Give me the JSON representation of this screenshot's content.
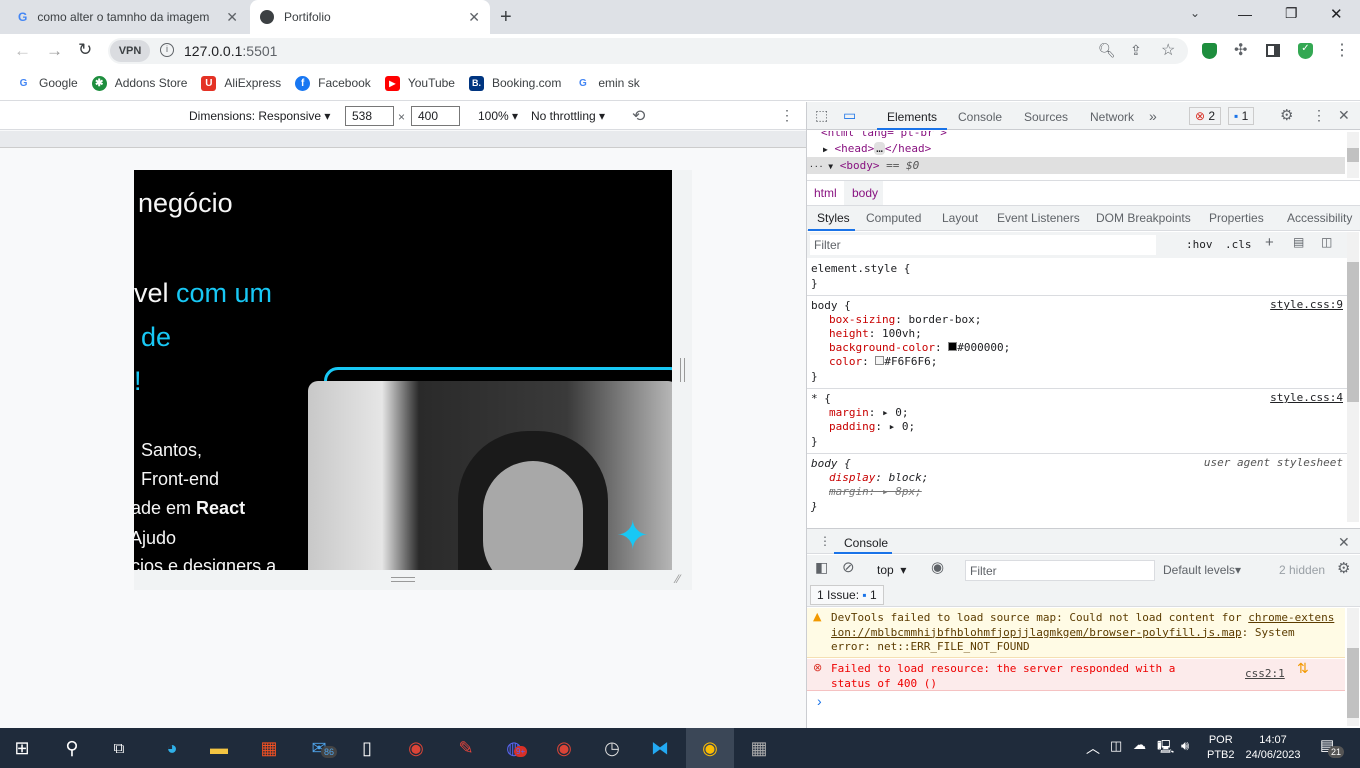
{
  "browser": {
    "tabs": [
      {
        "title": "como alter o tamnho da imagem",
        "icon": "google-icon"
      },
      {
        "title": "Portifolio",
        "icon": "globe-icon"
      }
    ],
    "vpn_label": "VPN",
    "url_host": "127.0.0.1",
    "url_port": ":5501",
    "bookmarks": [
      {
        "label": "Google",
        "color": "#4285f4",
        "glyph": "G"
      },
      {
        "label": "Addons Store",
        "color": "#1e8e3e",
        "glyph": "✱"
      },
      {
        "label": "AliExpress",
        "color": "#e43225",
        "glyph": "U"
      },
      {
        "label": "Facebook",
        "color": "#1877f2",
        "glyph": "f"
      },
      {
        "label": "YouTube",
        "color": "#ff0000",
        "glyph": "▶"
      },
      {
        "label": "Booking.com",
        "color": "#003580",
        "glyph": "B."
      },
      {
        "label": "emin sk",
        "color": "#4285f4",
        "glyph": "G"
      }
    ]
  },
  "device_toolbar": {
    "dimensions": "Dimensions: Responsive",
    "width": "538",
    "times": "×",
    "height": "400",
    "zoom": "100%",
    "throttling": "No throttling"
  },
  "page": {
    "line1": "negócio",
    "line2_white": "vel ",
    "line2_cyan": "com um",
    "line3_cyan": "de",
    "line4_cyan": "!",
    "p1": "Santos,",
    "p2": "Front-end",
    "p3_a": "ade em ",
    "p3_b": "React",
    ",p3_c": ",",
    "p4": "Ajudo",
    "p5": "cios e designers a",
    "accent": "#18c8f5"
  },
  "devtools": {
    "tabs": [
      "Elements",
      "Console",
      "Sources",
      "Network"
    ],
    "more": "»",
    "errors": "2",
    "messages": "1",
    "dom": {
      "html_line": "<html lang=\"pt-br\">",
      "head_open": "<head>",
      "head_close": "</head>",
      "body": "<body>",
      "body_suffix": "== $0"
    },
    "breadcrumbs": [
      "html",
      "body"
    ],
    "style_tabs": [
      "Styles",
      "Computed",
      "Layout",
      "Event Listeners",
      "DOM Breakpoints",
      "Properties",
      "Accessibility"
    ],
    "filter_placeholder": "Filter",
    "hov": ":hov",
    "cls": ".cls",
    "rules": [
      {
        "selector": "element.style {",
        "source": "",
        "props": [],
        "close": "}"
      },
      {
        "selector": "body {",
        "source": "style.css:9",
        "props": [
          {
            "name": "box-sizing",
            "value": "border-box;"
          },
          {
            "name": "height",
            "value": "100vh;"
          },
          {
            "name": "background-color",
            "value": "#000000;",
            "swatch": "#000000"
          },
          {
            "name": "color",
            "value": "#F6F6F6;",
            "swatch": "#F6F6F6"
          }
        ],
        "close": "}"
      },
      {
        "selector": "* {",
        "source": "style.css:4",
        "props": [
          {
            "name": "margin",
            "value": "▸ 0;"
          },
          {
            "name": "padding",
            "value": "▸ 0;"
          }
        ],
        "close": "}"
      },
      {
        "selector": "body {",
        "source": "user agent stylesheet",
        "props": [
          {
            "name": "display",
            "value": "block;"
          },
          {
            "name": "margin",
            "value": "▸ 8px;",
            "struck": true
          }
        ],
        "close": "}"
      }
    ],
    "console": {
      "title": "Console",
      "context": "top",
      "filter_placeholder": "Filter",
      "levels": "Default levels",
      "hidden": "2 hidden",
      "issues_label": "1 Issue:",
      "issues_count": "1",
      "warning": {
        "pre": "DevTools failed to load source map: Could not load content for ",
        "link": "chrome-extension://mblbcmmhijbfhblohmfjopjjlagmkgem/browser-polyfill.js.map",
        "post": ": System error: net::ERR_FILE_NOT_FOUND"
      },
      "error": {
        "text": "Failed to load resource: the server responded with a status of 400 ()",
        "source": "css2:1"
      },
      "prompt": "›"
    }
  },
  "taskbar": {
    "lang1": "POR",
    "lang2": "PTB2",
    "time": "14:07",
    "date": "24/06/2023",
    "notifications": "21",
    "mail_badge": "86",
    "discord_badge": "9+"
  }
}
